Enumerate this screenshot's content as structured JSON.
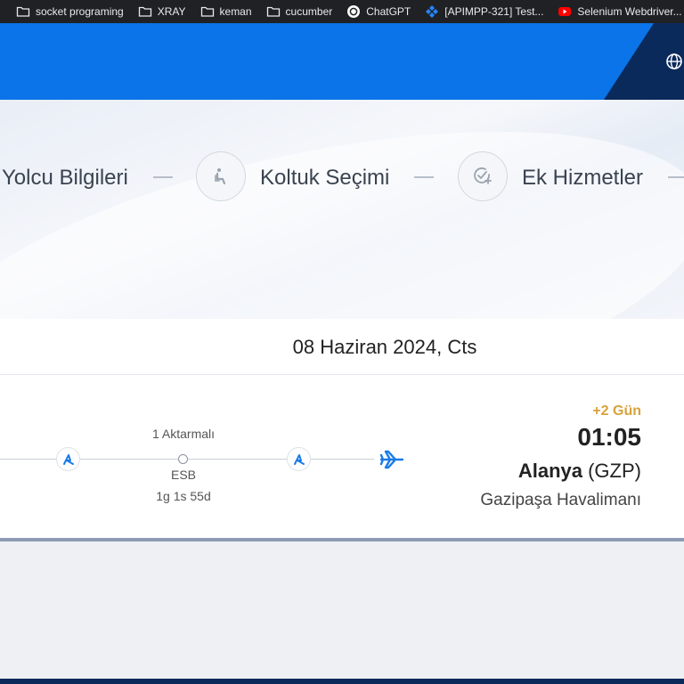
{
  "bookmarks": [
    {
      "label": "socket programing",
      "icon": "folder-icon"
    },
    {
      "label": "XRAY",
      "icon": "folder-icon"
    },
    {
      "label": "keman",
      "icon": "folder-icon"
    },
    {
      "label": "cucumber",
      "icon": "folder-icon"
    },
    {
      "label": "ChatGPT",
      "icon": "chatgpt-icon"
    },
    {
      "label": "[APIMPP-321] Test...",
      "icon": "jira-icon"
    },
    {
      "label": "Selenium Webdriver...",
      "icon": "youtube-icon"
    }
  ],
  "steps": [
    {
      "label": "Yolcu Bilgileri",
      "icon": "person-icon"
    },
    {
      "label": "Koltuk Seçimi",
      "icon": "seat-icon"
    },
    {
      "label": "Ek Hizmetler",
      "icon": "add-service-icon"
    }
  ],
  "flight": {
    "date": "08 Haziran 2024, Cts",
    "transfer_label": "1 Aktarmalı",
    "stop_code": "ESB",
    "stop_duration": "1g 1s 55d",
    "arrival": {
      "day_offset": "+2 Gün",
      "time": "01:05",
      "city": "Alanya",
      "code": "(GZP)",
      "airport": "Gazipaşa Havalimanı"
    }
  },
  "colors": {
    "header_blue": "#0a74e8",
    "navy": "#0b2a5c",
    "accent_gold": "#d9a23a",
    "icon_blue": "#1a7be8"
  }
}
